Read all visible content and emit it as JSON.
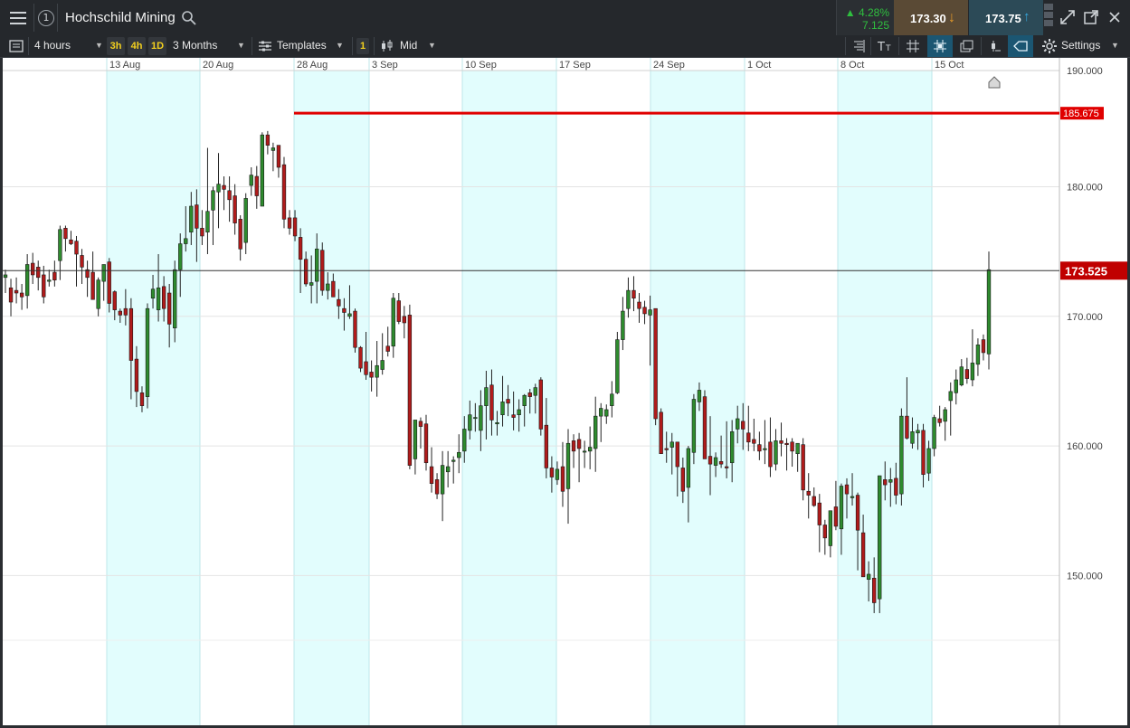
{
  "header": {
    "instrument": "Hochschild Mining",
    "info_icon": "info-circle-icon",
    "change_pct": "▲ 4.28%",
    "change_abs": "7.125",
    "sell_price": "173.30",
    "buy_price": "173.75"
  },
  "toolbar": {
    "interval": "4 hours",
    "quick_3h": "3h",
    "quick_4h": "4h",
    "quick_1d": "1D",
    "range": "3 Months",
    "templates": "Templates",
    "count_badge": "1",
    "price_type": "Mid",
    "settings": "Settings"
  },
  "colors": {
    "up": "#2e8b2e",
    "down": "#b01b1b",
    "shade": "#e2fdfd",
    "alert_line": "#e00000",
    "current_tag": "#c00000"
  },
  "chart_data": {
    "type": "candlestick",
    "x_ticks": [
      "13 Aug",
      "20 Aug",
      "28 Aug",
      "3 Sep",
      "10 Sep",
      "17 Sep",
      "24 Sep",
      "1 Oct",
      "8 Oct",
      "15 Oct"
    ],
    "y_ticks": [
      "180.000",
      "170.000",
      "160.000",
      "150.000"
    ],
    "y_top_label": "190.000",
    "ylim": [
      139,
      190
    ],
    "alert_level": 185.675,
    "alert_label": "185.675",
    "current_level": 173.525,
    "current_label": "173.525",
    "first_date": "6 Aug",
    "last_date": "17 Oct",
    "candles": [
      [
        173,
        173.6,
        171.8,
        173.2
      ],
      [
        172.2,
        172.9,
        170,
        171.1
      ],
      [
        172,
        173,
        171,
        171.8
      ],
      [
        171.8,
        172.5,
        170.5,
        171.5
      ],
      [
        171.6,
        174.8,
        170.6,
        174
      ],
      [
        174.1,
        174.9,
        172.5,
        173.2
      ],
      [
        173.8,
        174.3,
        172,
        173
      ],
      [
        173.2,
        173.9,
        171,
        171.5
      ],
      [
        172.7,
        173.6,
        172.3,
        172.8
      ],
      [
        173.4,
        174.3,
        172.3,
        172.8
      ],
      [
        174.3,
        177,
        172.8,
        176.7
      ],
      [
        176.8,
        177,
        175,
        176
      ],
      [
        175.9,
        176.6,
        175.5,
        175.6
      ],
      [
        175.8,
        176.2,
        172.3,
        174.8
      ],
      [
        174.7,
        175.2,
        172.5,
        173.8
      ],
      [
        173.6,
        174.3,
        171.5,
        173
      ],
      [
        173.4,
        175,
        172.6,
        171.3
      ],
      [
        170.6,
        173,
        170,
        172.8
      ],
      [
        172.7,
        174,
        171.2,
        174
      ],
      [
        174.2,
        174.5,
        170.3,
        171
      ],
      [
        171.9,
        172,
        169.7,
        170.5
      ],
      [
        170.4,
        170.6,
        169.5,
        170.1
      ],
      [
        170.6,
        172.1,
        169.3,
        170.1
      ],
      [
        170.6,
        171.4,
        163.6,
        166.6
      ],
      [
        166.7,
        167.7,
        163,
        164.2
      ],
      [
        164.1,
        164.6,
        162.6,
        163.1
      ],
      [
        163.8,
        171,
        162.9,
        170.6
      ],
      [
        171.4,
        173.2,
        170.6,
        172.1
      ],
      [
        170.5,
        174.8,
        169.6,
        172.2
      ],
      [
        172.3,
        173.1,
        169.6,
        170.6
      ],
      [
        171.8,
        172.5,
        167.6,
        169.4
      ],
      [
        169.1,
        174.3,
        168,
        173.6
      ],
      [
        173.6,
        176.4,
        171.5,
        175.6
      ],
      [
        175.6,
        178.5,
        175,
        176
      ],
      [
        176.5,
        179.6,
        175.5,
        178.5
      ],
      [
        178.6,
        179.8,
        174.2,
        176.8
      ],
      [
        176.8,
        178.2,
        175.5,
        176.2
      ],
      [
        176.5,
        183,
        174.8,
        178.1
      ],
      [
        178.2,
        180,
        175.5,
        179.7
      ],
      [
        179.6,
        182.6,
        176.8,
        180.2
      ],
      [
        180.1,
        180.8,
        178.2,
        179.8
      ],
      [
        179.7,
        180.8,
        177.3,
        179
      ],
      [
        179.3,
        180.2,
        176.3,
        177.2
      ],
      [
        177.5,
        177.8,
        174.3,
        175.2
      ],
      [
        175.7,
        179.5,
        174.8,
        179.1
      ],
      [
        180.1,
        181.5,
        179.3,
        180.9
      ],
      [
        180.8,
        181.6,
        178.3,
        179.3
      ],
      [
        178.5,
        184.2,
        179.6,
        184
      ],
      [
        184,
        184.3,
        182.5,
        183.2
      ],
      [
        182.8,
        183.4,
        181.2,
        183
      ],
      [
        183.2,
        182.8,
        180.7,
        181.5
      ],
      [
        181.7,
        182.3,
        176.8,
        177.5
      ],
      [
        177.6,
        178.2,
        176.3,
        176.8
      ],
      [
        177.6,
        178.2,
        175.8,
        176.2
      ],
      [
        176.1,
        176.8,
        171.8,
        174.4
      ],
      [
        174.4,
        175,
        172.3,
        172.5
      ],
      [
        172.4,
        174.7,
        171,
        172.6
      ],
      [
        172.7,
        176.4,
        171,
        175.2
      ],
      [
        175.1,
        175.7,
        171.6,
        172
      ],
      [
        172,
        173.4,
        171.3,
        172.5
      ],
      [
        172.7,
        173.3,
        172.2,
        171.5
      ],
      [
        171.3,
        172.1,
        169.8,
        170.8
      ],
      [
        170.6,
        171.4,
        168.9,
        170.3
      ],
      [
        170,
        172.4,
        169.8,
        170.2
      ],
      [
        170.4,
        170.6,
        167.2,
        167.6
      ],
      [
        167.6,
        167.7,
        165.7,
        166
      ],
      [
        166.5,
        168.8,
        165.1,
        165.5
      ],
      [
        165.7,
        166.6,
        164.2,
        165.3
      ],
      [
        165.3,
        168.1,
        163.8,
        166.2
      ],
      [
        165.9,
        168.7,
        165.5,
        166.6
      ],
      [
        167.7,
        169.2,
        166.9,
        167.3
      ],
      [
        167.7,
        171.8,
        166.8,
        171.4
      ],
      [
        171.2,
        171.8,
        169.4,
        169.6
      ],
      [
        170,
        170.8,
        168.3,
        169.5
      ],
      [
        170.1,
        170.9,
        158.2,
        158.5
      ],
      [
        159,
        161.5,
        157.8,
        162
      ],
      [
        161.9,
        162.2,
        159.8,
        161.5
      ],
      [
        161.7,
        162.4,
        158.1,
        158.7
      ],
      [
        158.4,
        159.9,
        156.4,
        157.1
      ],
      [
        157.4,
        157.9,
        155.9,
        156.3
      ],
      [
        156.3,
        159.6,
        154.2,
        158.5
      ],
      [
        158,
        159.6,
        156.8,
        158.4
      ],
      [
        158.8,
        159.2,
        157.1,
        158.9
      ],
      [
        159.1,
        160.9,
        157.9,
        159.5
      ],
      [
        159.6,
        162.3,
        158.7,
        161.3
      ],
      [
        161.2,
        163.5,
        160.5,
        162.4
      ],
      [
        162.2,
        163.3,
        161.1,
        162.2
      ],
      [
        161.2,
        164.3,
        159.6,
        163.1
      ],
      [
        163.1,
        165.8,
        160.5,
        164.5
      ],
      [
        164.7,
        165.9,
        160.8,
        162
      ],
      [
        161.7,
        162.7,
        160.8,
        161.8
      ],
      [
        162.4,
        165.4,
        161.5,
        163.4
      ],
      [
        163.6,
        164.7,
        162.3,
        163.3
      ],
      [
        162.4,
        164.2,
        161.2,
        162.2
      ],
      [
        162.4,
        163.6,
        161.1,
        162.8
      ],
      [
        163.1,
        164,
        161.5,
        163.9
      ],
      [
        164.1,
        164.4,
        162.5,
        163.8
      ],
      [
        163.9,
        164.8,
        162.5,
        164.5
      ],
      [
        165.1,
        165.3,
        160.8,
        161.3
      ],
      [
        161.6,
        163.7,
        157.5,
        158.3
      ],
      [
        158.3,
        159.2,
        156.4,
        157.6
      ],
      [
        157.4,
        158.8,
        157,
        158.2
      ],
      [
        158.4,
        160.3,
        155.3,
        156.5
      ],
      [
        156.7,
        161.3,
        154,
        160.2
      ],
      [
        160.4,
        160.9,
        158.3,
        159.6
      ],
      [
        160.5,
        161,
        157.2,
        159.8
      ],
      [
        159.6,
        160.4,
        158.3,
        159.6
      ],
      [
        159.6,
        161.5,
        158.2,
        159.9
      ],
      [
        159.8,
        163.8,
        158,
        162.3
      ],
      [
        162.3,
        163.3,
        160.3,
        162.9
      ],
      [
        162.3,
        163.2,
        161.7,
        162.8
      ],
      [
        163.1,
        165,
        162.2,
        164
      ],
      [
        164.1,
        168.8,
        164,
        168.2
      ],
      [
        168.2,
        171.5,
        167.4,
        170.4
      ],
      [
        170.6,
        173,
        169.9,
        172
      ],
      [
        172,
        173.1,
        170.4,
        171.4
      ],
      [
        171.1,
        171.8,
        169.5,
        170.6
      ],
      [
        170.7,
        171.2,
        169.4,
        170.2
      ],
      [
        170.1,
        171.6,
        166.2,
        170.5
      ],
      [
        170.6,
        170.5,
        161.6,
        162.1
      ],
      [
        162.6,
        162.9,
        159.5,
        159.4
      ],
      [
        159.8,
        161.1,
        158.7,
        159.7
      ],
      [
        159.9,
        161,
        157.8,
        160.3
      ],
      [
        160.3,
        160.2,
        156.1,
        158.4
      ],
      [
        158.3,
        159.1,
        155.6,
        156.5
      ],
      [
        156.8,
        160,
        154.1,
        159.8
      ],
      [
        159.5,
        164,
        158.6,
        163.6
      ],
      [
        163.4,
        164.9,
        162.7,
        164.3
      ],
      [
        163.8,
        164.3,
        160.2,
        159
      ],
      [
        159.2,
        162.3,
        156.2,
        158.6
      ],
      [
        158.5,
        159.5,
        157.6,
        159.1
      ],
      [
        158.8,
        160.8,
        158.3,
        158.6
      ],
      [
        158.4,
        161.9,
        157.5,
        158.3
      ],
      [
        158.7,
        162,
        157.2,
        161.1
      ],
      [
        161.3,
        163.1,
        160.2,
        162.1
      ],
      [
        161.9,
        163.3,
        159.7,
        161.3
      ],
      [
        161,
        163.1,
        159.6,
        160.3
      ],
      [
        160.5,
        162.1,
        159.6,
        160.2
      ],
      [
        160.1,
        161.1,
        158.9,
        159.6
      ],
      [
        159.7,
        162,
        158.6,
        159.8
      ],
      [
        160.3,
        162.2,
        157.6,
        158.4
      ],
      [
        158.6,
        161.3,
        158.1,
        160.4
      ],
      [
        160.4,
        161.8,
        159.2,
        160.2
      ],
      [
        160.2,
        160.6,
        158.1,
        160.1
      ],
      [
        160.3,
        160.6,
        158.4,
        159.6
      ],
      [
        159.4,
        160.1,
        158,
        160.2
      ],
      [
        160.1,
        160.6,
        155.8,
        156.6
      ],
      [
        156.5,
        157.9,
        154.4,
        156.2
      ],
      [
        156.1,
        156.8,
        155.3,
        155.4
      ],
      [
        155.6,
        156.3,
        151.8,
        153.9
      ],
      [
        153.9,
        154.3,
        151.6,
        152.9
      ],
      [
        152.3,
        154.3,
        151.4,
        155
      ],
      [
        155.3,
        157.3,
        153.5,
        153.8
      ],
      [
        153.6,
        157.1,
        151.6,
        156.9
      ],
      [
        157,
        157.5,
        154.4,
        156.3
      ],
      [
        156,
        157.9,
        155.4,
        156.1
      ],
      [
        156.2,
        156.4,
        150.4,
        153.5
      ],
      [
        153.3,
        154.7,
        150,
        149.9
      ],
      [
        149.7,
        151.1,
        148,
        150.1
      ],
      [
        149.8,
        151.4,
        147.1,
        147.9
      ],
      [
        148.2,
        155.4,
        147.1,
        157.7
      ],
      [
        157.4,
        158.8,
        155.8,
        157
      ],
      [
        157.2,
        158.3,
        155.3,
        157.4
      ],
      [
        157.5,
        158.7,
        155.5,
        156.2
      ],
      [
        156.3,
        162.9,
        155.4,
        162.3
      ],
      [
        162.3,
        165.3,
        160.5,
        160.6
      ],
      [
        160.2,
        162.2,
        159.8,
        161.1
      ],
      [
        161,
        161.7,
        159.7,
        161.2
      ],
      [
        161.2,
        161.7,
        156.8,
        157.8
      ],
      [
        157.9,
        160.4,
        157.3,
        159.8
      ],
      [
        159.8,
        162.4,
        159.2,
        162.2
      ],
      [
        162.1,
        163.1,
        161.5,
        161.8
      ],
      [
        161.9,
        163,
        160.4,
        162.8
      ],
      [
        163.5,
        164.9,
        160.8,
        164.2
      ],
      [
        164.1,
        165.9,
        163.2,
        165.1
      ],
      [
        164.7,
        166.7,
        164.6,
        166.1
      ],
      [
        165.9,
        166.8,
        164.8,
        165.2
      ],
      [
        165.1,
        169,
        164.6,
        166.4
      ],
      [
        166.3,
        168.3,
        165.4,
        167.8
      ],
      [
        168.2,
        168.6,
        166.6,
        167.2
      ],
      [
        167.1,
        175,
        165.9,
        173.6
      ]
    ]
  }
}
